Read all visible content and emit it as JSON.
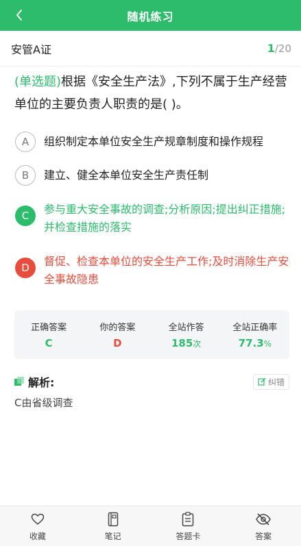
{
  "header": {
    "title": "随机练习",
    "back_icon": "chevron-left-icon"
  },
  "subheader": {
    "certificate": "安管A证",
    "current": "1",
    "total": "/20"
  },
  "question": {
    "type": "(单选题)",
    "text": "根据《安全生产法》,下列不属于生产经营单位的主要负责人职责的是( )。"
  },
  "options": [
    {
      "key": "A",
      "text": "组织制定本单位安全生产规章制度和操作规程",
      "state": "normal"
    },
    {
      "key": "B",
      "text": "建立、健全本单位安全生产责任制",
      "state": "normal"
    },
    {
      "key": "C",
      "text": "参与重大安全事故的调查;分析原因;提出纠正措施;并检查措施的落实",
      "state": "correct"
    },
    {
      "key": "D",
      "text": "督促、检查本单位的安全生产工作;及时消除生产安全事故隐患",
      "state": "wrong"
    }
  ],
  "stats": {
    "correct_answer": {
      "label": "正确答案",
      "value": "C"
    },
    "your_answer": {
      "label": "你的答案",
      "value": "D"
    },
    "site_attempts": {
      "label": "全站作答",
      "value": "185",
      "unit": "次"
    },
    "site_accuracy": {
      "label": "全站正确率",
      "value": "77.3",
      "unit": "%"
    }
  },
  "analysis": {
    "title": "解析:",
    "correction_label": "纠错",
    "body": "C由省级调查"
  },
  "tabbar": [
    {
      "label": "收藏",
      "icon": "heart-icon"
    },
    {
      "label": "笔记",
      "icon": "notebook-icon"
    },
    {
      "label": "答题卡",
      "icon": "answer-card-icon"
    },
    {
      "label": "答案",
      "icon": "eye-off-icon"
    }
  ],
  "colors": {
    "primary": "#2dbb6c",
    "wrong": "#e74c3c",
    "muted": "#999999"
  }
}
